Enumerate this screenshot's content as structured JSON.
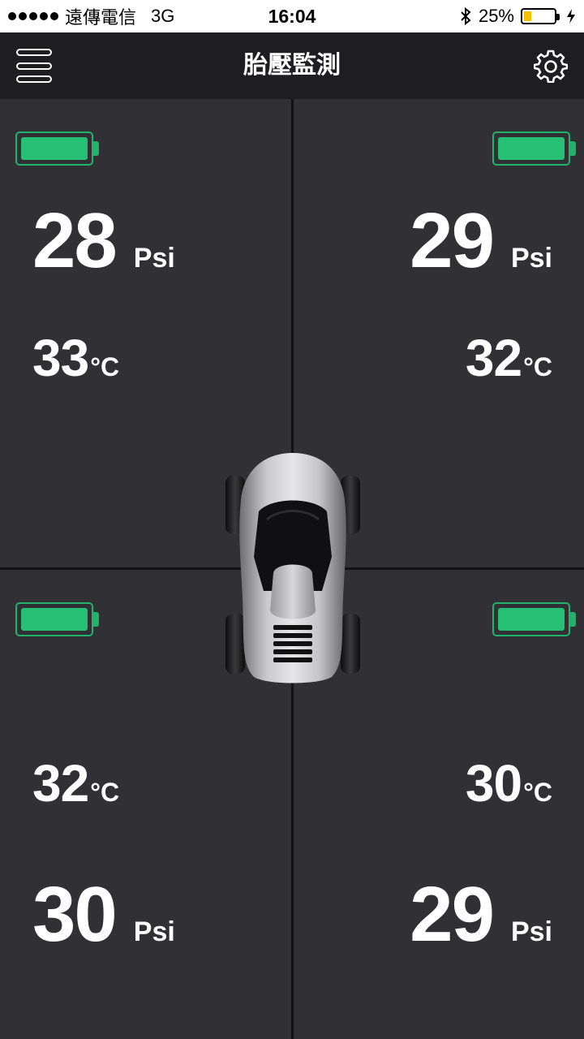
{
  "status_bar": {
    "carrier": "遠傳電信",
    "network": "3G",
    "time": "16:04",
    "battery_percent_text": "25%",
    "battery_level": 0.25,
    "battery_color": "#f2c200"
  },
  "nav": {
    "title": "胎壓監測",
    "menu_icon": "hamburger-menu-icon",
    "settings_icon": "gear-icon"
  },
  "colors": {
    "background": "#313035",
    "nav_background": "#1e1e22",
    "sensor_battery": "#26bf73",
    "text": "#ffffff"
  },
  "tires": {
    "front_left": {
      "pressure": "28",
      "pressure_unit": "Psi",
      "temperature": "33",
      "temperature_unit": "°C",
      "battery_level": 1.0
    },
    "front_right": {
      "pressure": "29",
      "pressure_unit": "Psi",
      "temperature": "32",
      "temperature_unit": "°C",
      "battery_level": 1.0
    },
    "rear_left": {
      "pressure": "30",
      "pressure_unit": "Psi",
      "temperature": "32",
      "temperature_unit": "°C",
      "battery_level": 1.0
    },
    "rear_right": {
      "pressure": "29",
      "pressure_unit": "Psi",
      "temperature": "30",
      "temperature_unit": "°C",
      "battery_level": 1.0
    }
  }
}
